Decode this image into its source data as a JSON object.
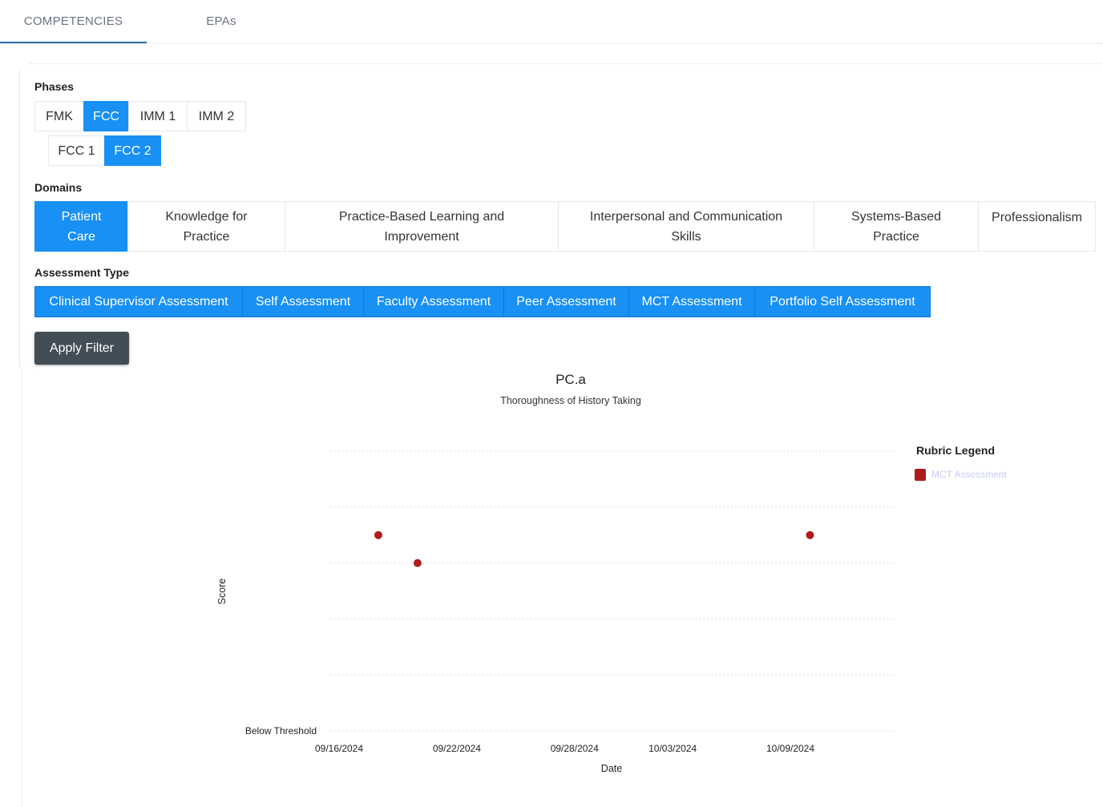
{
  "tabs": [
    {
      "label": "COMPETENCIES",
      "active": true
    },
    {
      "label": "EPAs",
      "active": false
    }
  ],
  "filters": {
    "phases_label": "Phases",
    "phases": [
      {
        "label": "FMK",
        "active": false
      },
      {
        "label": "FCC",
        "active": true
      },
      {
        "label": "IMM 1",
        "active": false
      },
      {
        "label": "IMM 2",
        "active": false
      }
    ],
    "subphases": [
      {
        "label": "FCC 1",
        "active": false
      },
      {
        "label": "FCC 2",
        "active": true
      }
    ],
    "domains_label": "Domains",
    "domains": [
      {
        "label": "Patient Care",
        "active": true
      },
      {
        "label": "Knowledge for Practice",
        "active": false
      },
      {
        "label": "Practice-Based Learning and Improvement",
        "active": false
      },
      {
        "label": "Interpersonal and Communication Skills",
        "active": false
      },
      {
        "label": "Systems-Based Practice",
        "active": false
      },
      {
        "label": "Professionalism",
        "active": false
      }
    ],
    "assessment_label": "Assessment Type",
    "assessment_types": [
      {
        "label": "Clinical Supervisor Assessment",
        "active": true
      },
      {
        "label": "Self Assessment",
        "active": true
      },
      {
        "label": "Faculty Assessment",
        "active": true
      },
      {
        "label": "Peer Assessment",
        "active": true
      },
      {
        "label": "MCT Assessment",
        "active": true
      },
      {
        "label": "Portfolio Self Assessment",
        "active": true
      }
    ],
    "apply_label": "Apply Filter"
  },
  "colors": {
    "accent": "#1890f4",
    "point": "#b01c1c",
    "apply": "#424d55"
  },
  "chart_data": {
    "type": "scatter",
    "title": "PC.a",
    "subtitle": "Thoroughness of History Taking",
    "xlabel": "Date",
    "ylabel": "Score",
    "x_ticks": [
      "09/16/2024",
      "09/22/2024",
      "09/28/2024",
      "10/03/2024",
      "10/09/2024"
    ],
    "y_ticks": [
      "Below Threshold"
    ],
    "ylim": [
      0,
      5
    ],
    "grid": true,
    "legend_title": "Rubric Legend",
    "legend_position": "right",
    "series": [
      {
        "name": "MCT Assessment",
        "color": "#b01c1c",
        "points": [
          {
            "x": "09/18/2024",
            "y": 3.5
          },
          {
            "x": "09/20/2024",
            "y": 3.0
          },
          {
            "x": "10/10/2024",
            "y": 3.5
          }
        ]
      }
    ]
  }
}
